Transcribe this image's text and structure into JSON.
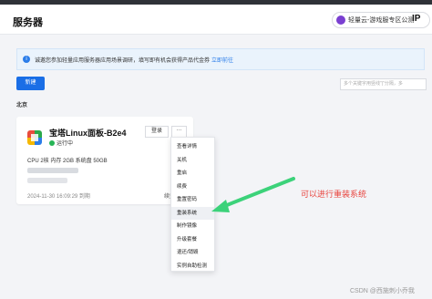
{
  "header": {
    "title": "服务器",
    "region_pill": "轻量云-游戏服专区公测",
    "ip_label": "IP"
  },
  "notice": {
    "text": "诚邀您参加轻量应用服务器应用场景调研，填写即有机会获得产品代金券",
    "link": "立即前往"
  },
  "toolbar": {
    "new_label": "新建",
    "search_placeholder": "多个关键字用竖线\"|\"分隔，多"
  },
  "region_title": "北京",
  "card": {
    "name": "宝塔Linux面板-B2e4",
    "status": "运行中",
    "login_label": "登录",
    "more_label": "···",
    "specs": "CPU 2核   内存 2GB   系统盘 50GB",
    "created": "2024-11-30 16:09:29 到期",
    "renew": "续费"
  },
  "menu": {
    "items": [
      {
        "label": "查看详情"
      },
      {
        "label": "关机"
      },
      {
        "label": "重启"
      },
      {
        "label": "续费"
      },
      {
        "label": "重置密码"
      },
      {
        "label": "重装系统"
      },
      {
        "label": "制作镜像"
      },
      {
        "label": "升级套餐"
      },
      {
        "label": "退还/销毁"
      },
      {
        "label": "实例自助检测"
      }
    ]
  },
  "annotation": "可以进行重装系统",
  "watermark": "CSDN @西施刺小乔我",
  "colors": {
    "primary": "#1a6ee6",
    "annotation_red": "#e8433d",
    "arrow_green": "#3cd27a",
    "running_green": "#26b456"
  }
}
